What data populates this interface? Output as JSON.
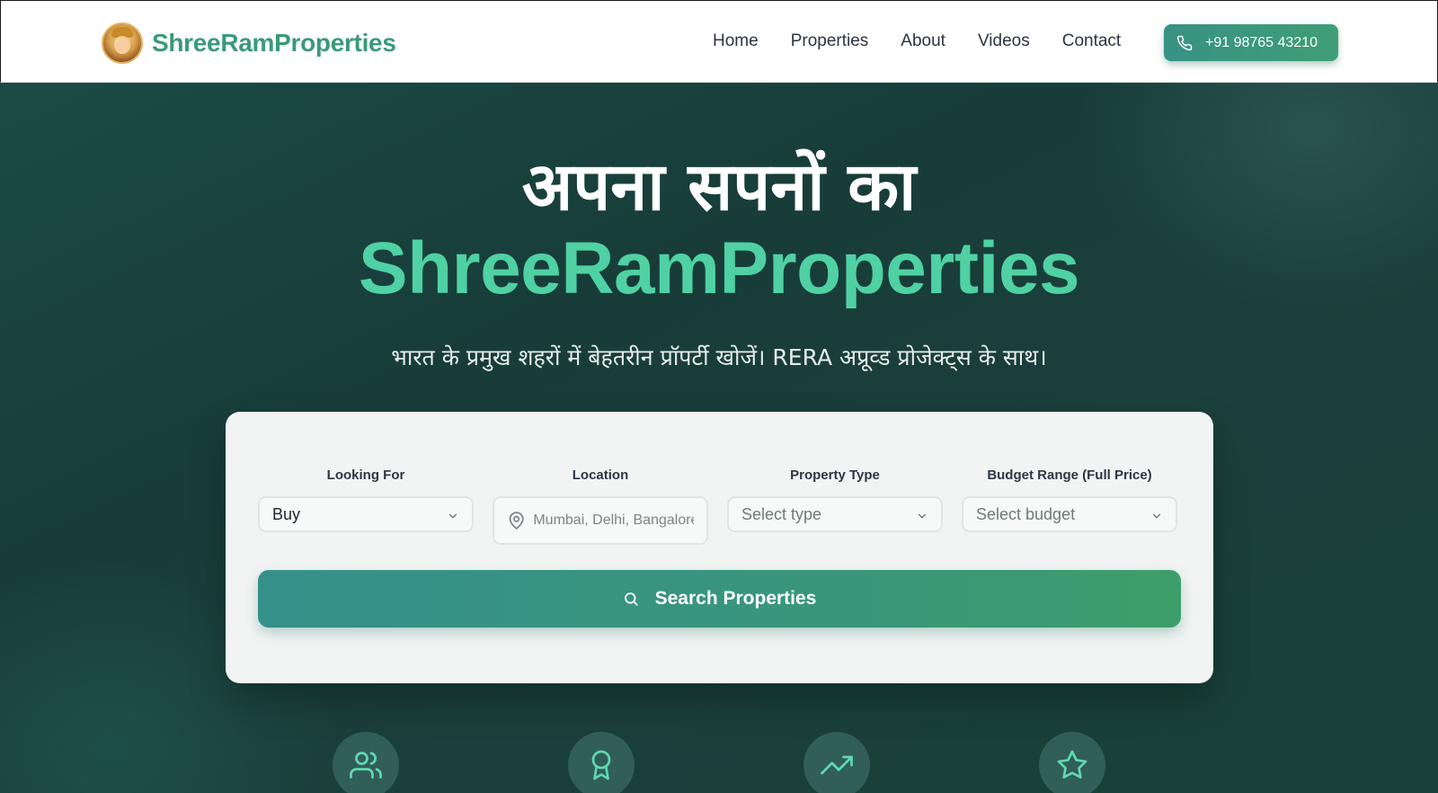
{
  "brand": {
    "name": "ShreeRamProperties",
    "logo_icon": "deity-avatar-icon"
  },
  "nav": {
    "items": [
      {
        "label": "Home"
      },
      {
        "label": "Properties"
      },
      {
        "label": "About"
      },
      {
        "label": "Videos"
      },
      {
        "label": "Contact"
      }
    ],
    "phone": {
      "label": "+91 98765 43210",
      "icon": "phone-icon"
    }
  },
  "hero": {
    "line1": "अपना सपनों का",
    "line2": "ShreeRamProperties",
    "subtitle": "भारत के प्रमुख शहरों में बेहतरीन प्रॉपर्टी खोजें। RERA अप्रूव्ड प्रोजेक्ट्स के साथ।"
  },
  "search": {
    "fields": [
      {
        "label": "Looking For",
        "value": "Buy",
        "icon": "chevron-down-icon"
      },
      {
        "label": "Location",
        "placeholder": "Mumbai, Delhi, Bangalore",
        "icon": "map-pin-icon"
      },
      {
        "label": "Property Type",
        "value": "Select type",
        "icon": "chevron-down-icon"
      },
      {
        "label": "Budget Range (Full Price)",
        "value": "Select budget",
        "icon": "chevron-down-icon"
      }
    ],
    "button": {
      "label": "Search Properties",
      "icon": "search-icon"
    }
  },
  "features": [
    {
      "icon": "users-icon"
    },
    {
      "icon": "award-icon"
    },
    {
      "icon": "trending-up-icon"
    },
    {
      "icon": "star-icon"
    }
  ],
  "colors": {
    "brand_green": "#3a9a77",
    "accent_mint": "#4fd1a4",
    "hero_bg": "#1b3f3a",
    "button_gradient_start": "#35908a",
    "button_gradient_end": "#3e9e6a"
  }
}
